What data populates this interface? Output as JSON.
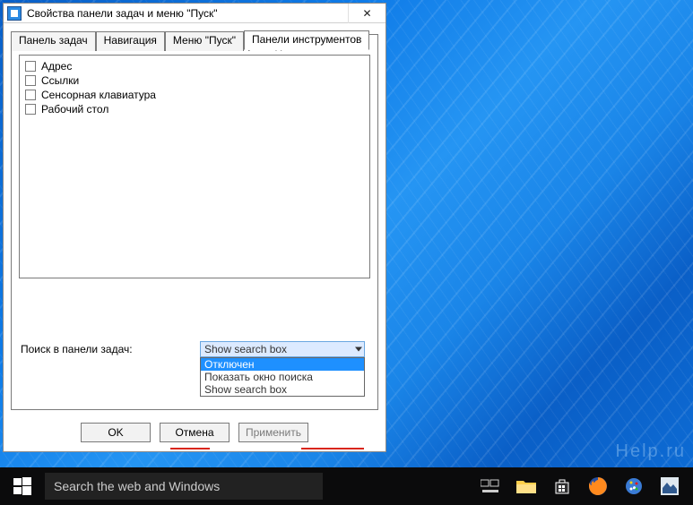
{
  "window": {
    "title": "Свойства панели задач и меню \"Пуск\"",
    "close_glyph": "✕"
  },
  "tabs": {
    "items": [
      {
        "label": "Панель задач"
      },
      {
        "label": "Навигация"
      },
      {
        "label": "Меню \"Пуск\""
      },
      {
        "label": "Панели инструментов"
      }
    ],
    "active_index": 3
  },
  "panel": {
    "prompt": "Выберите панели инструментов, которые нужно добавить в",
    "items": [
      {
        "label": "Адрес",
        "checked": false
      },
      {
        "label": "Ссылки",
        "checked": false
      },
      {
        "label": "Сенсорная клавиатура",
        "checked": false
      },
      {
        "label": "Рабочий стол",
        "checked": false
      }
    ]
  },
  "search": {
    "label": "Поиск в панели задач:",
    "selected": "Show search box",
    "options": [
      {
        "label": "Отключен",
        "highlighted": true
      },
      {
        "label": "Показать окно поиска",
        "highlighted": false
      },
      {
        "label": "Show search box",
        "highlighted": false
      }
    ]
  },
  "buttons": {
    "ok": "OK",
    "cancel": "Отмена",
    "apply": "Применить"
  },
  "taskbar": {
    "search_placeholder": "Search the web and Windows",
    "icons": [
      "task-view-icon",
      "file-explorer-icon",
      "store-icon",
      "firefox-icon",
      "paint-icon",
      "app-icon"
    ]
  },
  "watermark": "Help.ru",
  "annotation_colors": {
    "underline": "#d9261c",
    "arrow": "#d9261c"
  }
}
